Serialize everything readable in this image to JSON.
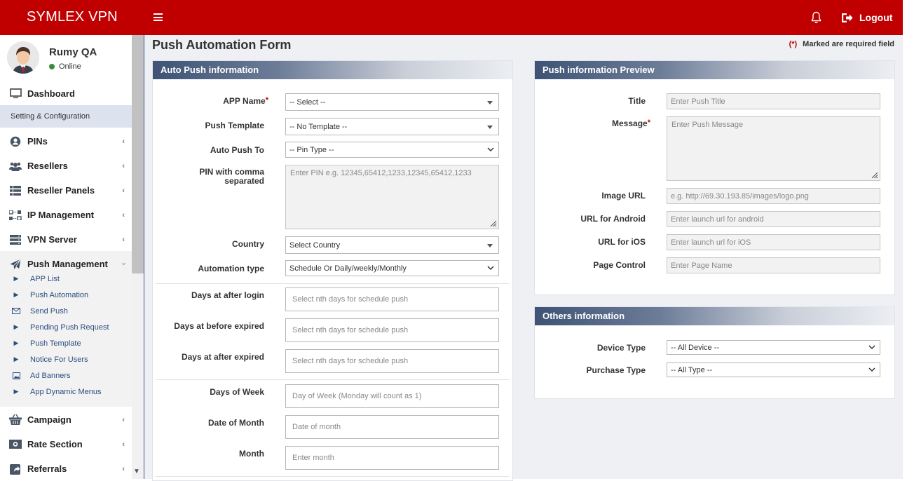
{
  "header": {
    "brand": "SYMLEX VPN",
    "logout_label": "Logout"
  },
  "user": {
    "name": "Rumy QA",
    "status": "Online"
  },
  "sidebar": {
    "dashboard": "Dashboard",
    "section": "Setting & Configuration",
    "items": [
      {
        "label": "PINs",
        "icon": "user-circle-icon"
      },
      {
        "label": "Resellers",
        "icon": "users-icon"
      },
      {
        "label": "Reseller Panels",
        "icon": "list-icon"
      },
      {
        "label": "IP Management",
        "icon": "network-icon"
      },
      {
        "label": "VPN Server",
        "icon": "server-icon"
      },
      {
        "label": "Push Management",
        "icon": "paper-plane-icon"
      }
    ],
    "push_sub": [
      {
        "label": "APP List"
      },
      {
        "label": "Push Automation"
      },
      {
        "label": "Send Push"
      },
      {
        "label": "Pending Push Request"
      },
      {
        "label": "Push Template"
      },
      {
        "label": "Notice For Users"
      },
      {
        "label": "Ad Banners"
      },
      {
        "label": "App Dynamic Menus"
      }
    ],
    "bottom": [
      {
        "label": "Campaign",
        "icon": "basket-icon"
      },
      {
        "label": "Rate Section",
        "icon": "money-icon"
      },
      {
        "label": "Referrals",
        "icon": "share-icon"
      }
    ]
  },
  "page": {
    "title": "Push Automation Form",
    "req_star": "(*)",
    "req_text": "Marked are required field"
  },
  "auto_push": {
    "heading": "Auto Push information",
    "app_name_label": "APP Name",
    "app_name_value": "-- Select --",
    "template_label": "Push Template",
    "template_value": "-- No Template --",
    "push_to_label": "Auto Push To",
    "push_to_value": "-- Pin Type --",
    "pin_label": "PIN with comma separated",
    "pin_placeholder": "Enter PIN e.g. 12345,65412,1233,12345,65412,1233",
    "country_label": "Country",
    "country_value": "Select Country",
    "automation_label": "Automation type",
    "automation_value": "Schedule Or Daily/weekly/Monthly",
    "after_login_label": "Days at after login",
    "after_login_ph": "Select nth days for schedule push",
    "before_exp_label": "Days at before expired",
    "before_exp_ph": "Select nth days for schedule push",
    "after_exp_label": "Days at after expired",
    "after_exp_ph": "Select nth days for schedule push",
    "dow_label": "Days of Week",
    "dow_ph": "Day of Week (Monday will count as 1)",
    "dom_label": "Date of Month",
    "dom_ph": "Date of month",
    "month_label": "Month",
    "month_ph": "Enter month"
  },
  "preview": {
    "heading": "Push information Preview",
    "title_label": "Title",
    "title_ph": "Enter Push Title",
    "message_label": "Message",
    "message_ph": "Enter Push Message",
    "image_label": "Image URL",
    "image_ph": "e.g. http://69.30.193.85/images/logo.png",
    "android_label": "URL for Android",
    "android_ph": "Enter launch url for android",
    "ios_label": "URL for iOS",
    "ios_ph": "Enter launch url for iOS",
    "page_label": "Page Control",
    "page_ph": "Enter Page Name"
  },
  "others": {
    "heading": "Others information",
    "device_label": "Device Type",
    "device_value": "-- All Device --",
    "purchase_label": "Purchase Type",
    "purchase_value": "-- All Type --"
  },
  "colors": {
    "brand_red": "#c00000",
    "nav_blue": "#2a4d7f"
  }
}
